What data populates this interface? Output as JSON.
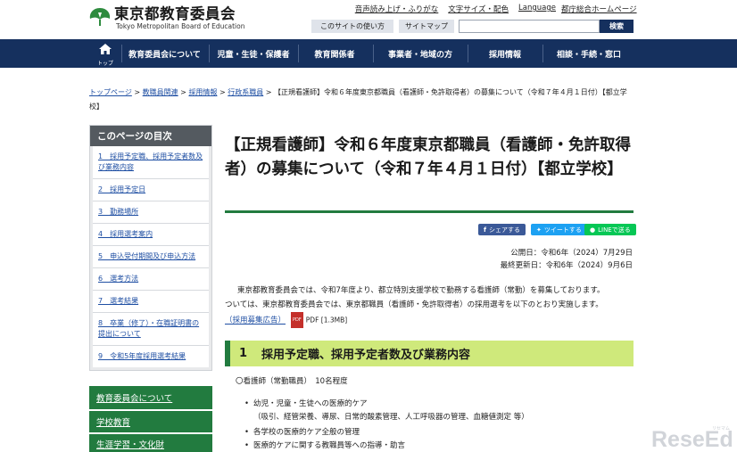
{
  "header": {
    "logo_jp": "東京都教育委員会",
    "logo_en": "Tokyo Metropolitan Board of Education",
    "util_links": [
      "音声読み上げ・ふりがな",
      "文字サイズ・配色",
      "Language"
    ],
    "util_link_gov": "都庁総合ホームページ",
    "how_to_use": "このサイトの使い方",
    "sitemap": "サイトマップ",
    "search_placeholder": "",
    "search_button": "検索"
  },
  "nav": {
    "home_label": "トップ",
    "items": [
      "教育委員会について",
      "児童・生徒・保護者",
      "教育関係者",
      "事業者・地域の方",
      "採用情報",
      "相談・手続・窓口"
    ]
  },
  "breadcrumb": {
    "items": [
      "トップページ",
      "教職員関連",
      "採用情報",
      "行政系職員"
    ],
    "sep": " > ",
    "current": "【正規看護師】令和６年度東京都職員（看護師・免許取得者）の募集について（令和７年４月１日付）【都立学校】"
  },
  "sidebar": {
    "toc_title": "このページの目次",
    "toc_items": [
      "1　採用予定職、採用予定者数及び業務内容",
      "2　採用予定日",
      "3　勤務場所",
      "4　採用選考案内",
      "5　申込受付期間及び申込方法",
      "6　選考方法",
      "7　選考結果",
      "8　卒業（修了）・在職証明書の提出について",
      "9　令和5年度採用選考結果"
    ],
    "links": [
      "教育委員会について",
      "学校教育",
      "生涯学習・文化財"
    ]
  },
  "main": {
    "title": "【正規看護師】令和６年度東京都職員（看護師・免許取得者）の募集について（令和７年４月１日付）【都立学校】",
    "share": {
      "facebook": "シェアする",
      "twitter": "ツイートする",
      "line": "LINEで送る"
    },
    "published": "公開日：令和6年（2024）7月29日",
    "updated": "最終更新日：令和6年（2024）9月6日",
    "para1": "東京都教育委員会では、令和7年度より、都立特別支援学校で勤務する看護師（常勤）を募集しております。",
    "para2": "ついては、東京都教育委員会では、東京都職員（看護師・免許取得者）の採用選考を以下のとおり実施します。",
    "pdf_link": "（採用募集広告）",
    "pdf_badge": "PDF",
    "pdf_size": "PDF [1.3MB]",
    "section1_num": "1",
    "section1_title": "採用予定職、採用予定者数及び業務内容",
    "job_line": "〇看護師（常勤職員）　10名程度",
    "bullets": [
      "幼児・児童・生徒への医療的ケア",
      "（吸引、経管栄養、導尿、日常的酸素管理、人工呼吸器の管理、血糖値測定 等）",
      "各学校の医療的ケア全般の管理",
      "医療的ケアに関する教職員等への指導・助言"
    ]
  },
  "watermark": {
    "text": "ReseEd",
    "sub": "リセマム"
  },
  "colors": {
    "navy": "#15305e",
    "green": "#227b3f",
    "section_bg": "#cfe97b",
    "link": "#1f4fa3"
  }
}
